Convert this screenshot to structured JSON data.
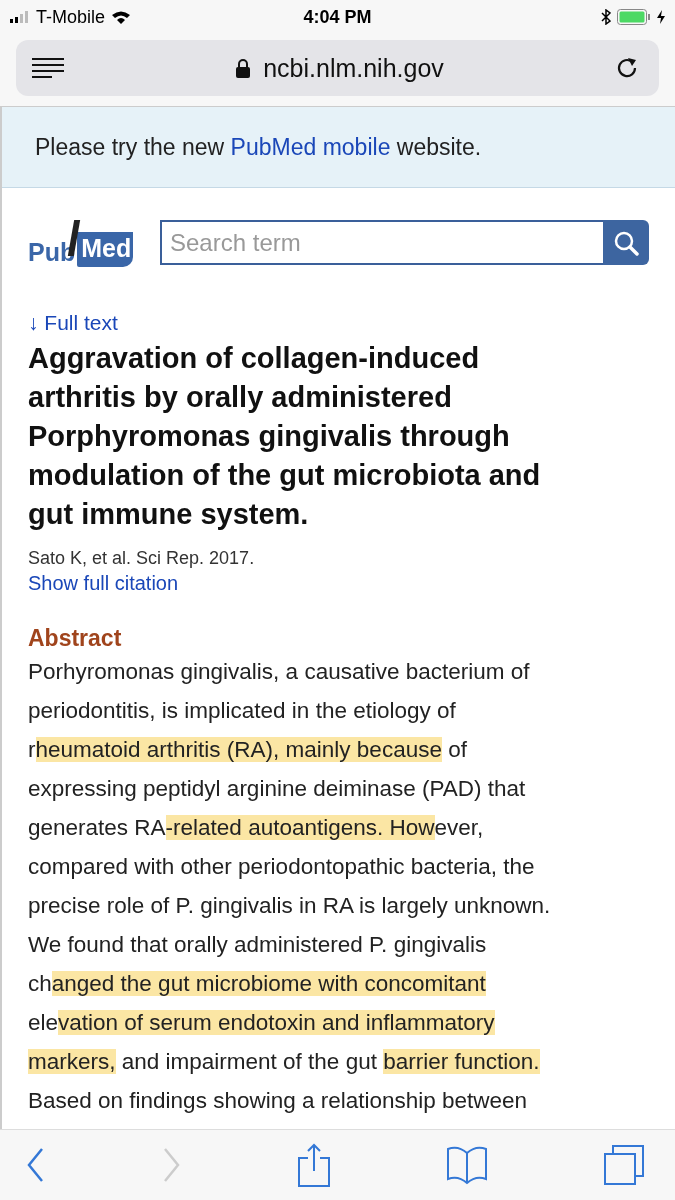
{
  "status_bar": {
    "carrier": "T-Mobile",
    "time": "4:04 PM"
  },
  "address_bar": {
    "url": "ncbi.nlm.nih.gov"
  },
  "banner": {
    "parts": [
      {
        "text": "Please try the new ",
        "link": false
      },
      {
        "text": "PubMed mobile",
        "link": true
      },
      {
        "text": " website.",
        "link": false
      }
    ]
  },
  "logo": {
    "left": "Pub",
    "right": "Med"
  },
  "search": {
    "placeholder": "Search term"
  },
  "full_text_link": "↓ Full text",
  "article": {
    "title": "Aggravation of collagen-induced arthritis by orally administered Porphyromonas gingivalis through modulation of the gut microbiota and gut immune system.",
    "citation": "Sato K, et al. Sci Rep. 2017.",
    "citation_link": "Show full citation"
  },
  "abstract": {
    "heading": "Abstract",
    "lines": [
      [
        {
          "text": "Porhyromonas gingivalis, a causative bacterium of",
          "highlighted": false
        }
      ],
      [
        {
          "text": "periodontitis, is implicated in the etiology of",
          "highlighted": false
        }
      ],
      [
        {
          "text": "r",
          "highlighted": false
        },
        {
          "text": "heumatoid arthritis (RA), mainly because",
          "highlighted": true
        },
        {
          "text": " of",
          "highlighted": false
        }
      ],
      [
        {
          "text": "expressing peptidyl arginine deiminase (PAD) that",
          "highlighted": false
        }
      ],
      [
        {
          "text": "generates RA",
          "highlighted": false
        },
        {
          "text": "-related autoantigens. How",
          "highlighted": true
        },
        {
          "text": "ever,",
          "highlighted": false
        }
      ],
      [
        {
          "text": "compared with other periodontopathic bacteria, the",
          "highlighted": false
        }
      ],
      [
        {
          "text": "precise role of P. gingivalis in RA is largely unknown.",
          "highlighted": false
        }
      ],
      [
        {
          "text": "We found that orally administered P. gingivalis",
          "highlighted": false
        }
      ],
      [
        {
          "text": "ch",
          "highlighted": false
        },
        {
          "text": "anged the gut microbiome with concomitant",
          "highlighted": true
        }
      ],
      [
        {
          "text": "ele",
          "highlighted": false
        },
        {
          "text": "vation of serum endotoxin and inflammatory",
          "highlighted": true
        }
      ],
      [
        {
          "text": "markers,",
          "highlighted": true
        },
        {
          "text": " and impairment of the gut ",
          "highlighted": false
        },
        {
          "text": "barrier function.",
          "highlighted": true
        }
      ],
      [
        {
          "text": "Based on findings showing a relationship between",
          "highlighted": false
        }
      ]
    ]
  },
  "toolbar": [
    {
      "kind": "back",
      "disabled": false
    },
    {
      "kind": "forward",
      "disabled": true
    },
    {
      "kind": "share",
      "disabled": false
    },
    {
      "kind": "bookmarks",
      "disabled": false
    },
    {
      "kind": "tabs",
      "disabled": false
    }
  ]
}
